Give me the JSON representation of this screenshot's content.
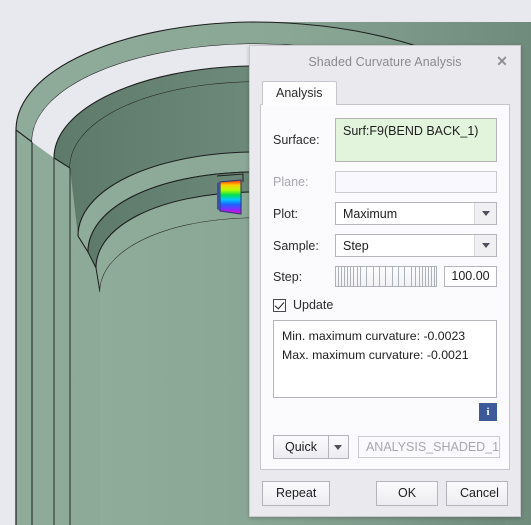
{
  "dialog": {
    "title": "Shaded Curvature Analysis",
    "close_icon": "close-icon",
    "tabs": [
      {
        "label": "Analysis",
        "active": true
      }
    ],
    "fields": {
      "surface_label": "Surface:",
      "surface_value": "Surf:F9(BEND BACK_1)",
      "plane_label": "Plane:",
      "plane_value": "",
      "plot_label": "Plot:",
      "plot_value": "Maximum",
      "sample_label": "Sample:",
      "sample_value": "Step",
      "step_label": "Step:",
      "step_value": "100.00"
    },
    "update": {
      "label": "Update",
      "checked": true
    },
    "results": {
      "line1": "Min. maximum curvature: -0.0023",
      "line2": "Max. maximum curvature: -0.0021"
    },
    "info_button": {
      "glyph": "i",
      "icon": "info-icon",
      "color": "#3c5a99"
    },
    "quick": {
      "label": "Quick",
      "dropdown_icon": "chevron-down-icon",
      "name_value": "ANALYSIS_SHADED_1"
    },
    "footer": {
      "repeat_label": "Repeat",
      "ok_label": "OK",
      "cancel_label": "Cancel"
    }
  },
  "viewport": {
    "name": "3d-model-viewport",
    "background_color": "#e8e9ee",
    "model_color_light": "#87a392",
    "model_color_mid": "#7d9a8a",
    "model_color_dark": "#6e8a7a",
    "model_color_darker": "#63806f",
    "edge_color": "#1e1e1e",
    "curvature_patch": {
      "name": "curvature-color-patch",
      "colors": [
        "#ff00c8",
        "#4040ff",
        "#00c8ff",
        "#00e050",
        "#b0ff00",
        "#ffd000",
        "#ff2000"
      ]
    }
  }
}
